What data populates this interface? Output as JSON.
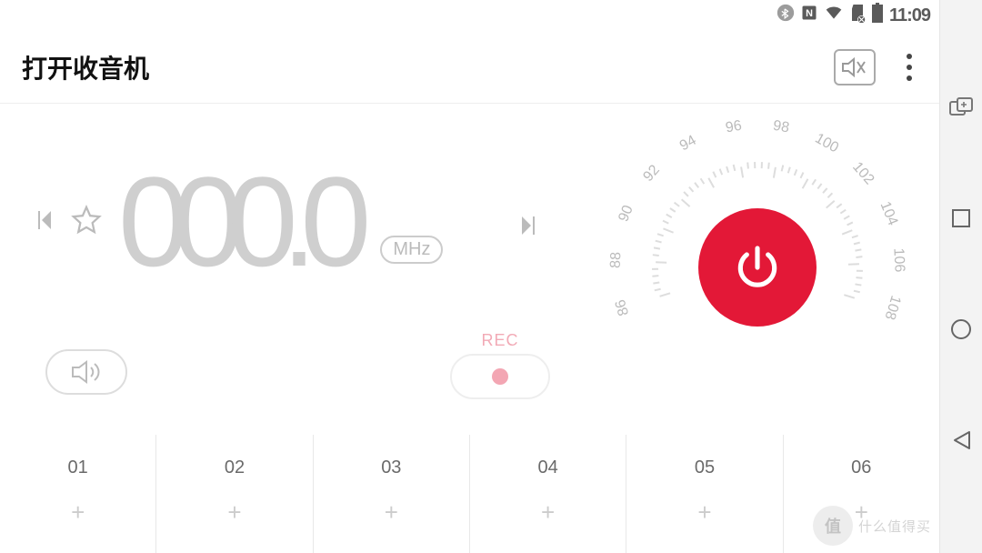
{
  "statusbar": {
    "time": "11:09"
  },
  "appbar": {
    "title": "打开收音机"
  },
  "tuner": {
    "frequency": "000.0",
    "unit": "MHz",
    "rec_label": "REC"
  },
  "dial_numbers": [
    "86",
    "88",
    "90",
    "92",
    "94",
    "96",
    "98",
    "100",
    "102",
    "104",
    "106",
    "108"
  ],
  "presets": [
    {
      "num": "01"
    },
    {
      "num": "02"
    },
    {
      "num": "03"
    },
    {
      "num": "04"
    },
    {
      "num": "05"
    },
    {
      "num": "06"
    }
  ],
  "watermark": {
    "logo": "值",
    "text": "什么值得买"
  }
}
